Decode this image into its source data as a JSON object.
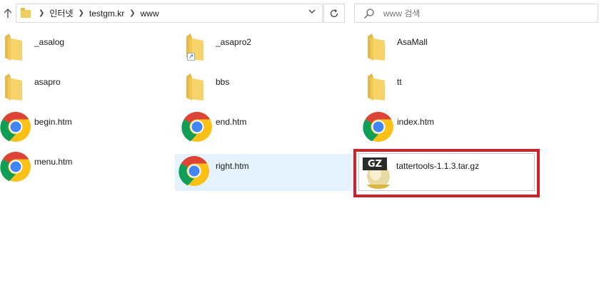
{
  "address": {
    "crumbs": [
      "인터넷",
      "testgm.kr",
      "www"
    ]
  },
  "search": {
    "placeholder": "www 검색"
  },
  "files": [
    {
      "name": "_asalog",
      "type": "folder"
    },
    {
      "name": "_asapro2",
      "type": "folder-shortcut"
    },
    {
      "name": "AsaMall",
      "type": "folder"
    },
    {
      "name": "asapro",
      "type": "folder"
    },
    {
      "name": "bbs",
      "type": "folder"
    },
    {
      "name": "tt",
      "type": "folder"
    },
    {
      "name": "begin.htm",
      "type": "chrome-html"
    },
    {
      "name": "end.htm",
      "type": "chrome-html"
    },
    {
      "name": "index.htm",
      "type": "chrome-html"
    },
    {
      "name": "menu.htm",
      "type": "chrome-html"
    },
    {
      "name": "right.htm",
      "type": "chrome-html",
      "selected": true
    },
    {
      "name": "tattertools-1.1.3.tar.gz",
      "type": "gz-archive",
      "highlighted": true
    }
  ],
  "gz_badge": "GZ",
  "colors": {
    "selection": "#e5f3ff",
    "highlight_border": "#d0202a",
    "folder": "#f3cd5b"
  }
}
